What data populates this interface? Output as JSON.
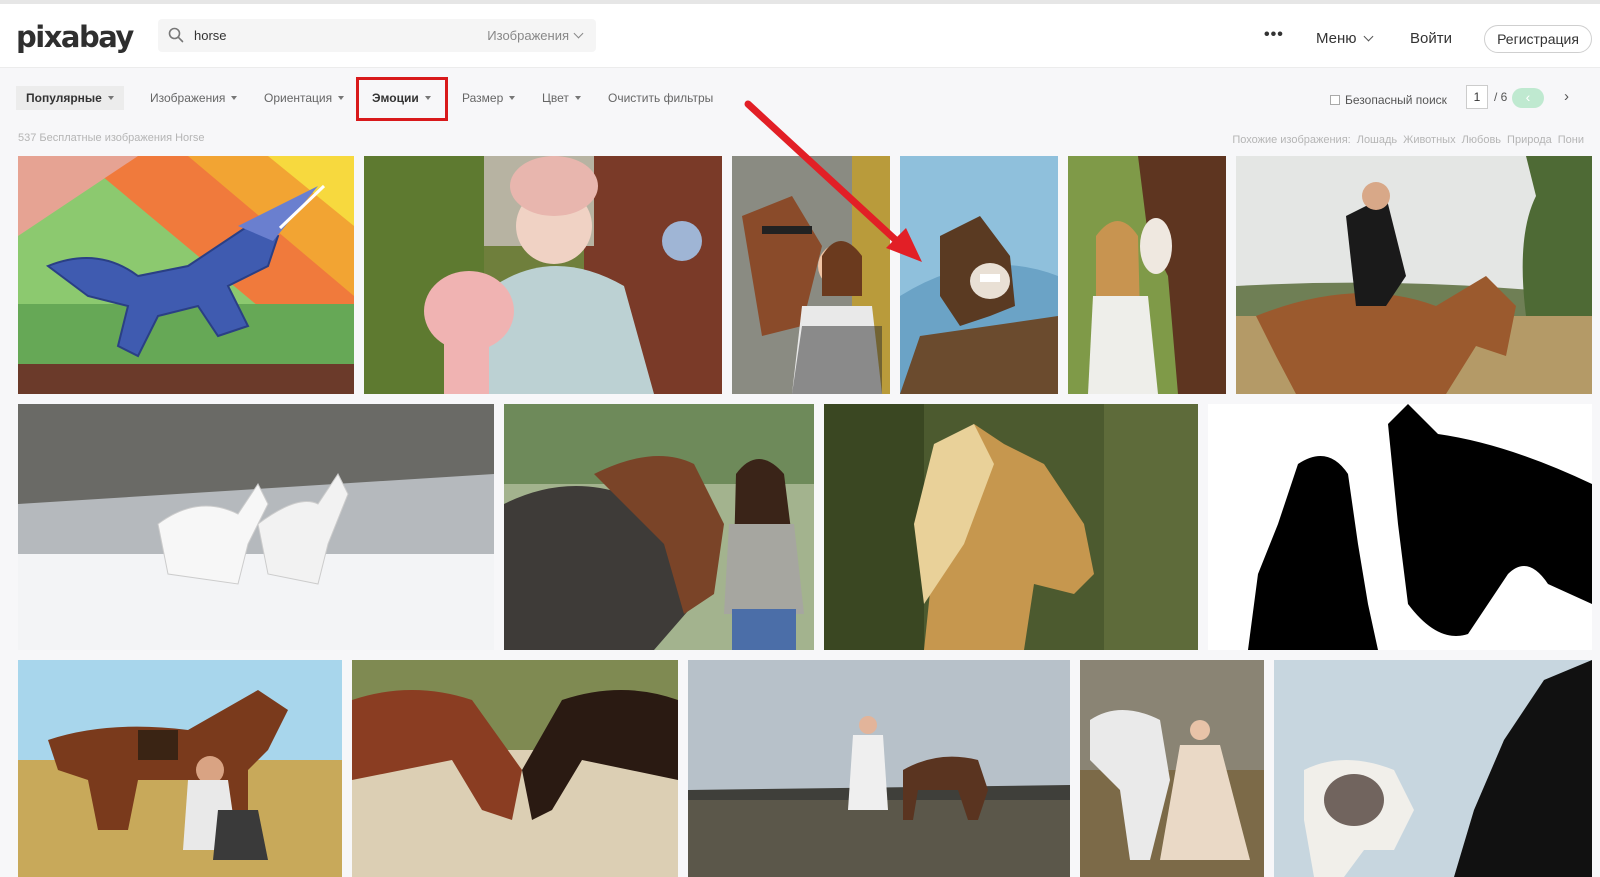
{
  "header": {
    "logo": "pixabay",
    "search": {
      "value": "horse",
      "type_label": "Изображения"
    },
    "more": "•••",
    "menu_label": "Меню",
    "login_label": "Войти",
    "register_label": "Регистрация"
  },
  "filters": {
    "sort_label": "Популярные",
    "items": [
      "Изображения",
      "Ориентация",
      "Эмоции",
      "Размер",
      "Цвет"
    ],
    "clear_label": "Очистить фильтры",
    "safe_search_label": "Безопасный поиск",
    "pagination": {
      "current": "1",
      "total": "/ 6",
      "prev": "‹",
      "next": "›"
    }
  },
  "results": {
    "count_text": "537 Бесплатные изображения Horse",
    "related_label": "Похожие изображения:",
    "related_tags": [
      "Лошадь",
      "Животных",
      "Любовь",
      "Природа",
      "Пони"
    ]
  },
  "colors": {
    "accent": "#4bc07a",
    "highlight": "#d8191b"
  }
}
